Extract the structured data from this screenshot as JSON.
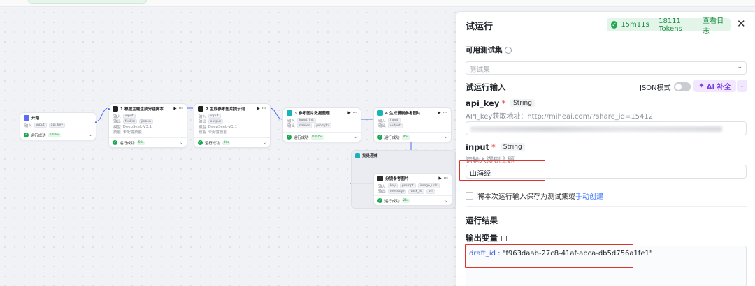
{
  "canvas": {
    "nodes": {
      "start": {
        "title": "开始",
        "input_label": "输入",
        "tags": [
          "input",
          "api_key"
        ],
        "status": "运行成功",
        "time": "0.026s"
      },
      "n1": {
        "title": "1.根据主题生成分镜脚本",
        "input_label": "输入",
        "input_tags": [
          "input"
        ],
        "output_label": "输出",
        "output_tags": [
          "fenlist",
          "jieben"
        ],
        "model_label": "模型",
        "model": "DeepSeek-V3.1",
        "skill_label": "技能",
        "skill": "未配置技能",
        "status": "运行成功",
        "time": "58s"
      },
      "n2": {
        "title": "2.生成参考图片提示词",
        "input_label": "输入",
        "input_tags": [
          "input"
        ],
        "output_label": "输出",
        "output_tags": [
          "output"
        ],
        "model_label": "模型",
        "model": "DeepSeek-V3.1",
        "skill_label": "技能",
        "skill": "未配置技能",
        "status": "运行成功",
        "time": "30s"
      },
      "n3": {
        "title": "3.参考图片数据整理",
        "input_label": "输入",
        "input_tags": [
          "input_list"
        ],
        "output_label": "输出",
        "output_tags": [
          "names",
          "prompts"
        ],
        "status": "运行成功",
        "time": "0.025s"
      },
      "n4": {
        "title": "4.生成漫剧参考图片",
        "input_label": "输入",
        "input_tags": [
          "input"
        ],
        "output_label": "输出",
        "output_tags": [
          "output"
        ],
        "status": "运行成功",
        "time": "45s"
      },
      "batch": {
        "title": "批处理体",
        "inner_title": "分镜参考图片",
        "input_label": "输入",
        "input_tags": [
          "key",
          "prompt",
          "image_urls"
        ],
        "output_label": "输出",
        "output_tags": [
          "message",
          "task_id",
          "url"
        ],
        "status": "运行成功",
        "time": "25s"
      }
    }
  },
  "panel": {
    "title": "试运行",
    "status": {
      "time": "15m11s",
      "tokens": "18111 Tokens",
      "log_link": "查看日志",
      "color": "#1fa94f"
    },
    "testset": {
      "label": "可用测试集",
      "placeholder": "测试集"
    },
    "run_input": {
      "label": "试运行输入",
      "json_mode": "JSON模式",
      "ai_button": "AI 补全"
    },
    "fields": [
      {
        "name": "api_key",
        "type": "String",
        "hint": "API_key获取地址：http://miheai.com/?share_id=15412",
        "value": ""
      },
      {
        "name": "input",
        "type": "String",
        "hint": "请输入漫剧主题",
        "value": "山海经"
      }
    ],
    "save_checkbox": {
      "text": "将本次运行输入保存为测试集或",
      "link": "手动创建"
    },
    "result": {
      "label": "运行结果",
      "output_label": "输出变量",
      "output": {
        "key": "draft_id",
        "value": "\"f963daab-27c8-41af-abca-db5d756a1fe1\""
      }
    },
    "accent": "#e0322d"
  }
}
